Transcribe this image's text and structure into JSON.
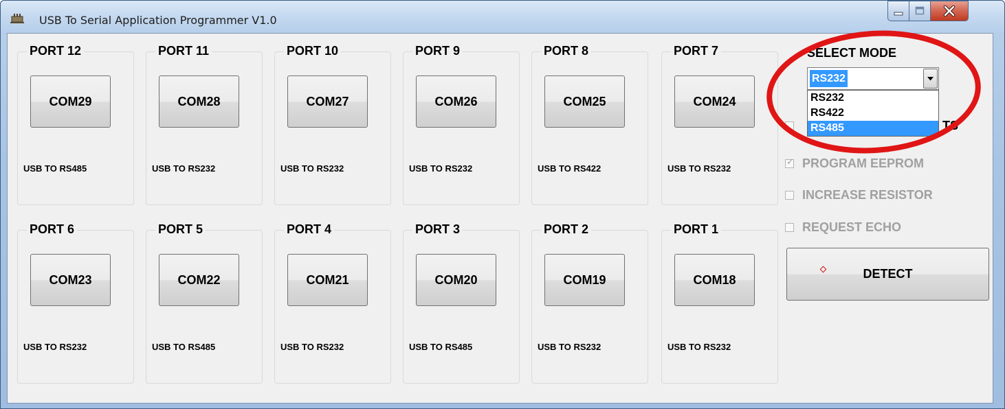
{
  "window": {
    "title": "USB To Serial Application Programmer V1.0",
    "controls": [
      "minimize-icon",
      "maximize-icon",
      "close-icon"
    ]
  },
  "ports": [
    {
      "title": "PORT 12",
      "com": "COM29",
      "type": "USB TO RS485"
    },
    {
      "title": "PORT 11",
      "com": "COM28",
      "type": "USB TO RS232"
    },
    {
      "title": "PORT 10",
      "com": "COM27",
      "type": "USB TO RS232"
    },
    {
      "title": "PORT 9",
      "com": "COM26",
      "type": "USB TO RS232"
    },
    {
      "title": "PORT 8",
      "com": "COM25",
      "type": "USB TO RS422"
    },
    {
      "title": "PORT 7",
      "com": "COM24",
      "type": "USB TO RS232"
    },
    {
      "title": "PORT 6",
      "com": "COM23",
      "type": "USB TO RS232"
    },
    {
      "title": "PORT 5",
      "com": "COM22",
      "type": "USB TO RS485"
    },
    {
      "title": "PORT 4",
      "com": "COM21",
      "type": "USB TO RS232"
    },
    {
      "title": "PORT 3",
      "com": "COM20",
      "type": "USB TO RS485"
    },
    {
      "title": "PORT 2",
      "com": "COM19",
      "type": "USB TO RS232"
    },
    {
      "title": "PORT 1",
      "com": "COM18",
      "type": "USB TO RS232"
    }
  ],
  "mode": {
    "label": "SELECT MODE",
    "value": "RS232",
    "options": [
      "RS232",
      "RS422",
      "RS485"
    ],
    "highlighted_option": "RS485",
    "dropdown_open": true
  },
  "options": [
    {
      "label": "TS",
      "checked": false
    },
    {
      "label": "PROGRAM EEPROM",
      "checked": true
    },
    {
      "label": "INCREASE RESISTOR",
      "checked": false
    },
    {
      "label": "REQUEST ECHO",
      "checked": false
    }
  ],
  "detect_label": "DETECT",
  "colors": {
    "selection": "#3399ff",
    "annotation": "#e01515",
    "disabled_text": "#a0a0a0"
  }
}
